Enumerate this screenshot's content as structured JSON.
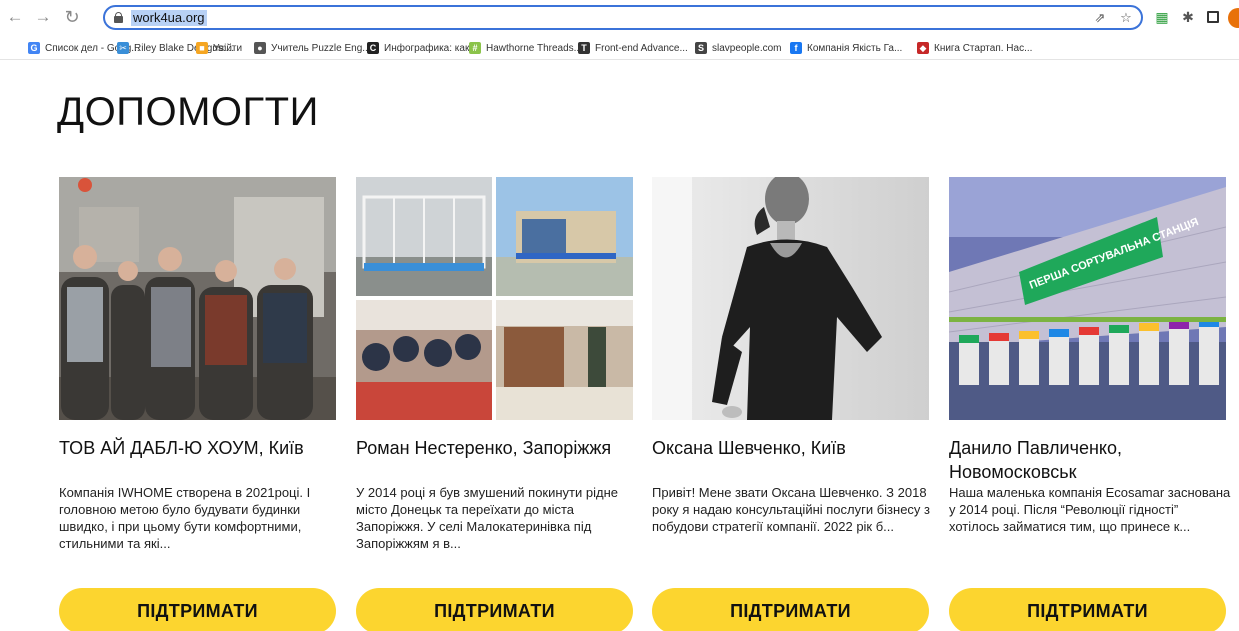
{
  "browser": {
    "url": "work4ua.org",
    "bookmarks": [
      {
        "label": "Список дел - Goog...",
        "icon": "google-icon",
        "color": "#4285f4",
        "glyph": "G"
      },
      {
        "label": "Riley Blake Designs:...",
        "icon": "riley-blake-icon",
        "color": "#3a8fd8",
        "glyph": "✂"
      },
      {
        "label": "Увійти",
        "icon": "login-icon",
        "color": "#f5a623",
        "glyph": "■"
      },
      {
        "label": "Учитель Puzzle Eng...",
        "icon": "puzzle-english-icon",
        "color": "#555555",
        "glyph": "●"
      },
      {
        "label": "Инфографика: как...",
        "icon": "infographic-icon",
        "color": "#222222",
        "glyph": "C"
      },
      {
        "label": "Hawthorne Threads...",
        "icon": "hawthorne-icon",
        "color": "#8bc34a",
        "glyph": "#"
      },
      {
        "label": "Front-end Advance...",
        "icon": "frontend-icon",
        "color": "#333333",
        "glyph": "T"
      },
      {
        "label": "slavpeople.com",
        "icon": "slavpeople-icon",
        "color": "#444444",
        "glyph": "S"
      },
      {
        "label": "Компанія Якість Га...",
        "icon": "facebook-icon",
        "color": "#1877f2",
        "glyph": "f"
      },
      {
        "label": "Книга Стартап. Нас...",
        "icon": "book-icon",
        "color": "#c62828",
        "glyph": "◆"
      }
    ]
  },
  "page": {
    "title": "ДОПОМОГТИ",
    "button_label": "ПІДТРИМАТИ",
    "cards": [
      {
        "name": "ТОВ АЙ ДАБЛ-Ю ХОУМ, Київ",
        "desc": "Компанія IWHOME створена в 2021році. І головною метою було будувати будинки швидко, і при цьому бути комфортними, стильними та які..."
      },
      {
        "name": "Роман Нестеренко, Запоріжжя",
        "desc": "У 2014 році я був змушений покинути рідне місто Донецьк та переїхати до міста Запоріжжя. У селі Малокатеринівка під Запоріжжям я в..."
      },
      {
        "name": "Оксана Шевченко, Київ",
        "desc": "Привіт!  Мене звати Оксана Шевченко. З 2018 року я надаю консультаційні послуги бізнесу з побудови стратегії компанії.  2022 рік б..."
      },
      {
        "name": "Данило Павличенко, Новомосковськ",
        "desc": "Наша маленька компанія Ecosamar заснована у 2014 році. Після “Революції гідності” хотілось займатися тим, що принесе к...",
        "banner_text": "ПЕРША СОРТУВАЛЬНА СТАНЦІЯ"
      }
    ]
  },
  "colors": {
    "accent": "#fcd52f",
    "omnibox_border": "#3b73d9",
    "url_highlight": "#b8d1f5"
  }
}
